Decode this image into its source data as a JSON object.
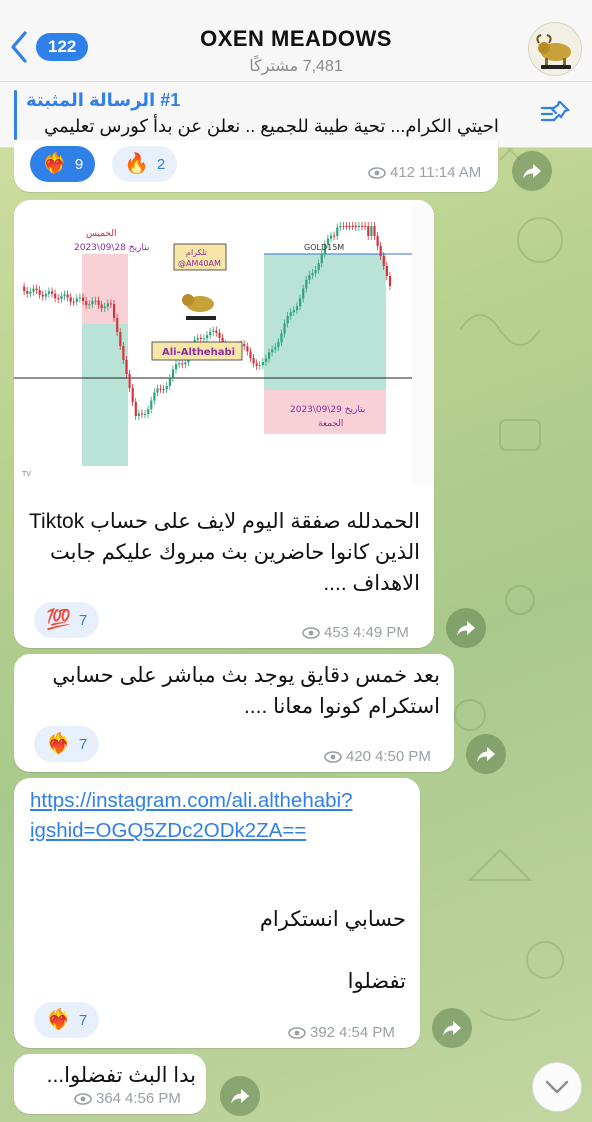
{
  "header": {
    "back_count": "122",
    "title": "OXEN MEADOWS",
    "subscribers": "7,481 مشتركًا"
  },
  "pinned": {
    "title": "#1 الرسالة المثبتة",
    "text": "احيتي الكرام... تحية طيبة للجميع .. نعلن عن بدأ كورس تعليمي"
  },
  "messages": [
    {
      "reactions": [
        {
          "emoji": "❤️‍🔥",
          "count": "9",
          "state": "active"
        },
        {
          "emoji": "🔥",
          "count": "2",
          "state": "inactive"
        }
      ],
      "views": "412",
      "time": "11:14 AM"
    },
    {
      "chart": {
        "symbol": "GOLD15M",
        "label_telegram": "تلكرام",
        "handle": "@AM40AM",
        "name_tag": "Ali-Althehabi",
        "date_left": "الخميس بتاريخ 28\\09\\2023",
        "date_right": "بتاريخ 29\\09\\2023 الجمعة"
      },
      "text": "الحمدلله صفقة اليوم لايف على حساب Tiktok الذين كانوا حاضرين بث مبروك عليكم جابت الاهداف ....",
      "reactions": [
        {
          "emoji": "💯",
          "count": "7",
          "state": "inactive"
        }
      ],
      "views": "453",
      "time": "4:49 PM"
    },
    {
      "text": "بعد خمس دقايق يوجد بث مباشر على حسابي استكرام كونوا معانا ....",
      "reactions": [
        {
          "emoji": "❤️‍🔥",
          "count": "7",
          "state": "inactive"
        }
      ],
      "views": "420",
      "time": "4:50 PM"
    },
    {
      "link_line1": "https://instagram.com/ali.althehabi?",
      "link_line2": "igshid=OGQ5ZDc2ODk2ZA==",
      "text1": "حسابي انستكرام",
      "text2": "تفضلوا",
      "reactions": [
        {
          "emoji": "❤️‍🔥",
          "count": "7",
          "state": "inactive"
        }
      ],
      "views": "392",
      "time": "4:54 PM"
    },
    {
      "text": "بدا البث تفضلوا...",
      "views": "364",
      "time": "4:56 PM"
    }
  ],
  "colors": {
    "accent": "#2f80e8",
    "bubble": "#ffffff",
    "reaction_inactive_bg": "#e7f0fb"
  }
}
